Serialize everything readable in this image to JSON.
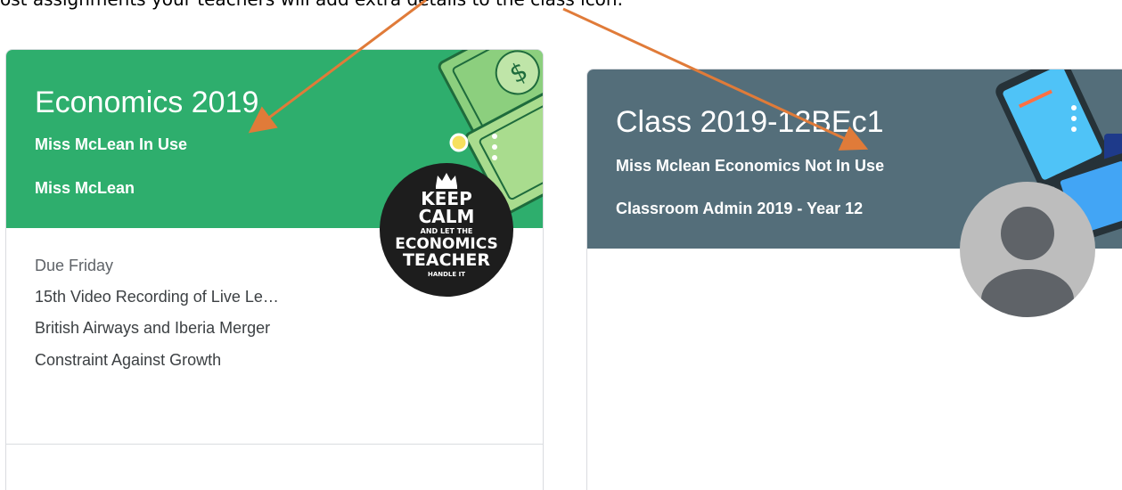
{
  "caption": {
    "text": "ost assignments your teachers will add extra details to the class icon."
  },
  "cards": [
    {
      "title": "Economics 2019",
      "section": "Miss McLean In Use",
      "teacher": "Miss McLean",
      "due_label": "Due Friday",
      "assignments": [
        "15th Video Recording of Live Le…",
        "British Airways and Iberia Merger",
        "Constraint Against Growth"
      ],
      "header_color": "#2eae6d",
      "header_icon": "money-icon",
      "avatar": {
        "lines": [
          "KEEP",
          "CALM",
          "AND LET THE",
          "ECONOMICS",
          "TEACHER",
          "HANDLE IT"
        ]
      }
    },
    {
      "title": "Class 2019-12BEc1",
      "section": "Miss Mclean Economics Not In Use",
      "teacher": "Classroom Admin 2019 - Year 12",
      "header_color": "#546e7a",
      "header_icon": "tablet-icon",
      "avatar_icon": "person-icon"
    }
  ],
  "annotation_color": "#e07b39"
}
